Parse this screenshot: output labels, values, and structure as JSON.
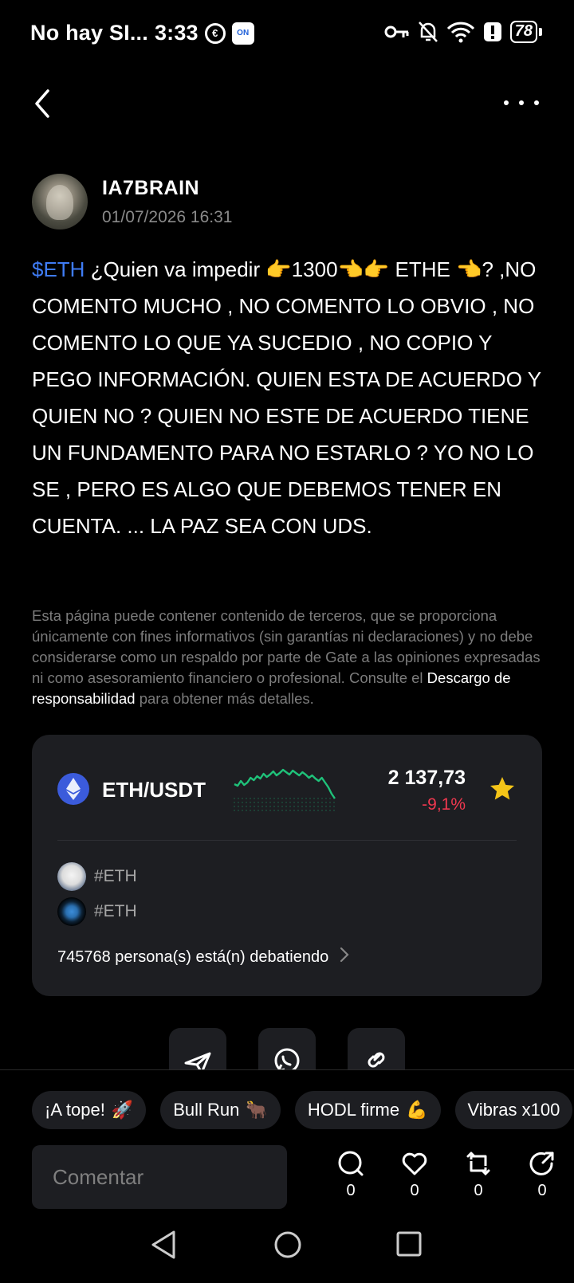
{
  "status_bar": {
    "carrier": "No hay SI...",
    "time": "3:33",
    "app_icon_text": "ON",
    "battery": "78"
  },
  "post": {
    "author": "IA7BRAIN",
    "date": "01/07/2026 16:31",
    "tag": "$ETH",
    "body": " ¿Quien va impedir 👉1300👈👉 ETHE 👈? ,NO COMENTO MUCHO , NO COMENTO LO OBVIO , NO COMENTO LO QUE YA SUCEDIO , NO COPIO Y PEGO INFORMACIÓN. QUIEN ESTA DE ACUERDO Y QUIEN NO ? QUIEN NO ESTE DE ACUERDO TIENE UN FUNDAMENTO PARA NO ESTARLO ? YO NO LO SE , PERO ES ALGO QUE DEBEMOS TENER EN CUENTA. ... LA PAZ SEA CON UDS."
  },
  "disclaimer": {
    "text_before": "Esta página puede contener contenido de terceros, que se proporciona únicamente con fines informativos (sin garantías ni declaraciones) y no debe considerarse como un respaldo por parte de Gate a las opiniones expresadas ni como asesoramiento financiero o profesional. Consulte el ",
    "link": "Descargo de responsabilidad",
    "text_after": " para obtener más detalles."
  },
  "market": {
    "pair": "ETH/USDT",
    "price": "2 137,73",
    "change": "-9,1%",
    "favorite": true,
    "colors": {
      "positive": "#1fc27a",
      "negative": "#f0384f",
      "star": "#f5c518"
    },
    "sparkline": [
      62,
      60,
      66,
      61,
      64,
      70,
      67,
      72,
      69,
      75,
      71,
      74,
      78,
      73,
      76,
      80,
      77,
      74,
      79,
      76,
      73,
      77,
      74,
      70,
      73,
      69,
      66,
      70,
      64,
      58,
      50,
      44
    ],
    "topics": [
      "#ETH",
      "#ETH"
    ],
    "debating": "745768 persona(s) está(n) debatiendo"
  },
  "share": {
    "icons": [
      "telegram-icon",
      "whatsapp-icon",
      "link-icon"
    ]
  },
  "reactions": [
    {
      "label": "¡A tope!",
      "emoji": "🚀"
    },
    {
      "label": "Bull Run",
      "emoji": "🐂"
    },
    {
      "label": "HODL firme",
      "emoji": "💪"
    },
    {
      "label": "Vibras x100",
      "emoji": ""
    }
  ],
  "comment": {
    "placeholder": "Comentar"
  },
  "actions": {
    "comments": "0",
    "likes": "0",
    "reposts": "0",
    "shares": "0"
  }
}
